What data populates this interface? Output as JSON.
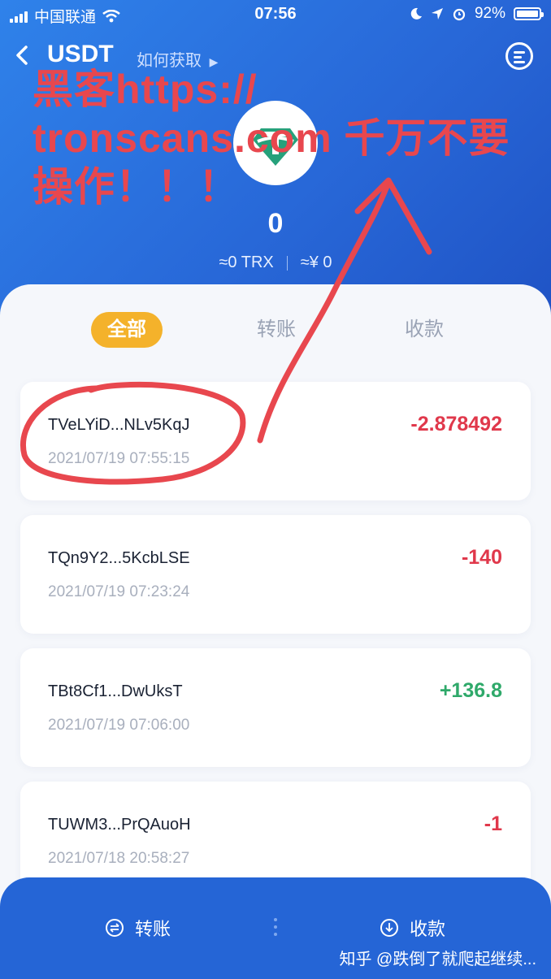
{
  "status_bar": {
    "carrier": "中国联通",
    "time": "07:56",
    "battery": "92%"
  },
  "nav": {
    "title": "USDT",
    "how_to_get": "如何获取"
  },
  "token": {
    "balance": "0",
    "trx_value": "≈0 TRX",
    "cny_value": "≈¥ 0"
  },
  "tabs": [
    {
      "label": "全部",
      "active": true
    },
    {
      "label": "转账",
      "active": false
    },
    {
      "label": "收款",
      "active": false
    }
  ],
  "transactions": [
    {
      "address": "TVeLYiD...NLv5KqJ",
      "date": "2021/07/19 07:55:15",
      "amount": "-2.878492",
      "direction": "out"
    },
    {
      "address": "TQn9Y2...5KcbLSE",
      "date": "2021/07/19 07:23:24",
      "amount": "-140",
      "direction": "out"
    },
    {
      "address": "TBt8Cf1...DwUksT",
      "date": "2021/07/19 07:06:00",
      "amount": "+136.8",
      "direction": "in"
    },
    {
      "address": "TUWM3...PrQAuoH",
      "date": "2021/07/18 20:58:27",
      "amount": "-1",
      "direction": "out"
    }
  ],
  "bottom_bar": {
    "transfer_label": "转账",
    "receive_label": "收款"
  },
  "annotation": {
    "line1": "黑客https://",
    "line2": "tronscans.com 千万不要",
    "line3": "操作！！！"
  },
  "watermark": "知乎 @跌倒了就爬起继续...",
  "colors": {
    "header_blue": "#2868d8",
    "active_tab": "#f4b22b",
    "negative": "#e0384b",
    "positive": "#2fa96a",
    "annotation_red": "#e8474e"
  }
}
